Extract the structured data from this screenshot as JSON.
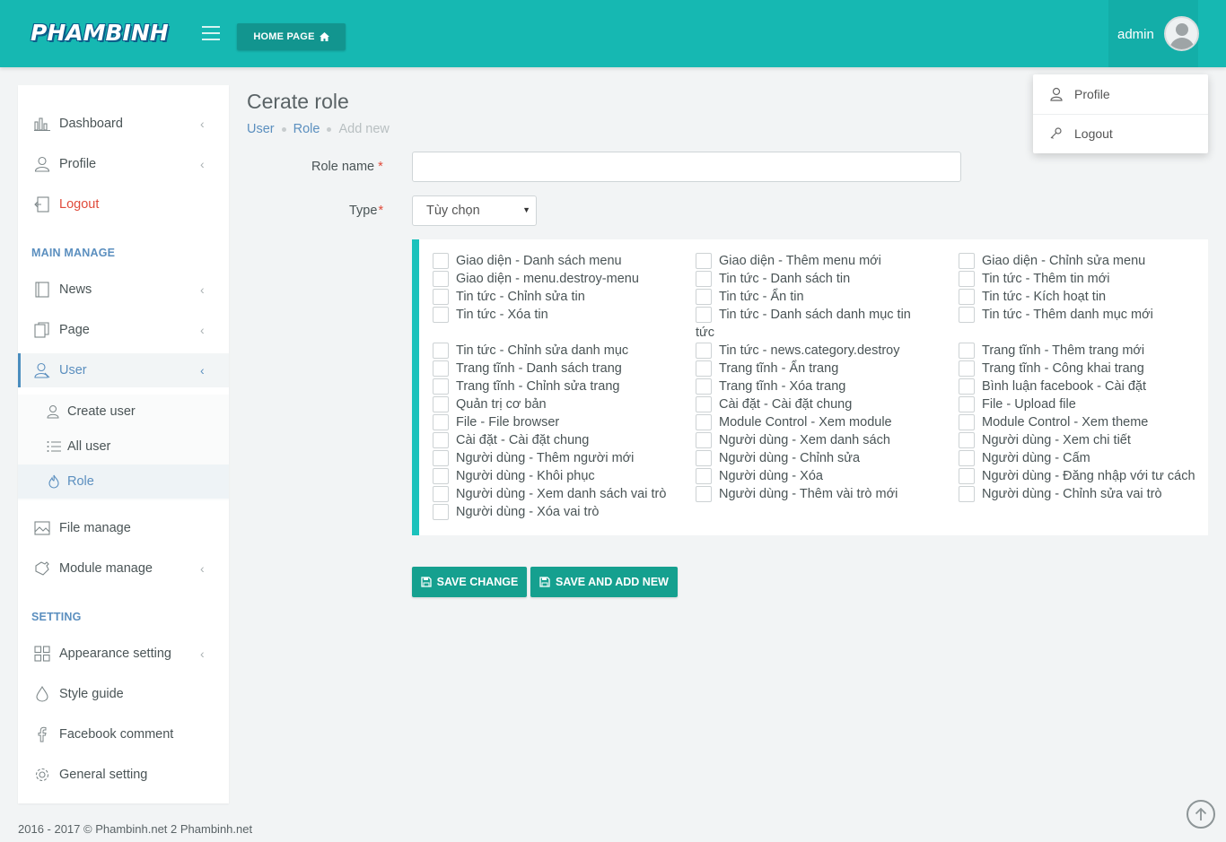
{
  "header": {
    "logo": "PHAMBINH",
    "home_button": "HOME PAGE",
    "user_name": "admin"
  },
  "user_dropdown": {
    "items": [
      {
        "label": "Profile",
        "icon": "user-icon"
      },
      {
        "label": "Logout",
        "icon": "key-icon"
      }
    ]
  },
  "sidebar": {
    "items": [
      {
        "label": "Dashboard",
        "icon": "bar-chart-icon"
      },
      {
        "label": "Profile",
        "icon": "user-icon"
      },
      {
        "label": "Logout",
        "icon": "logout-icon"
      }
    ],
    "section_main": "MAIN MANAGE",
    "main_items": [
      {
        "label": "News",
        "icon": "book-icon"
      },
      {
        "label": "Page",
        "icon": "pages-icon"
      },
      {
        "label": "User",
        "icon": "user-icon"
      }
    ],
    "user_sub_items": [
      {
        "label": "Create user",
        "icon": "user-add-icon"
      },
      {
        "label": "All user",
        "icon": "list-icon"
      },
      {
        "label": "Role",
        "icon": "fire-icon"
      }
    ],
    "more_items": [
      {
        "label": "File manage",
        "icon": "image-icon"
      },
      {
        "label": "Module manage",
        "icon": "puzzle-icon"
      }
    ],
    "section_setting": "SETTING",
    "setting_items": [
      {
        "label": "Appearance setting",
        "icon": "grid-icon"
      },
      {
        "label": "Style guide",
        "icon": "drop-icon"
      },
      {
        "label": "Facebook comment",
        "icon": "facebook-icon"
      },
      {
        "label": "General setting",
        "icon": "gear-icon"
      }
    ]
  },
  "main": {
    "title": "Cerate role",
    "breadcrumb": [
      "User",
      "Role",
      "Add new"
    ],
    "form": {
      "role_name_label": "Role name",
      "role_name_value": "",
      "type_label": "Type",
      "type_value": "Tùy chọn",
      "required_mark": "*"
    },
    "permissions": {
      "col1": [
        "Giao diện - Danh sách menu",
        "Giao diện - menu.destroy-menu",
        "Tin tức - Chỉnh sửa tin",
        "Tin tức - Xóa tin",
        "Tin tức - Chỉnh sửa danh mục",
        "Trang tĩnh - Danh sách trang",
        "Trang tĩnh - Chỉnh sửa trang",
        "Quản trị cơ bản",
        "File - File browser",
        "Cài đặt - Cài đặt chung",
        "Người dùng - Thêm người mới",
        "Người dùng - Khôi phục",
        "Người dùng - Xem danh sách vai trò",
        "Người dùng - Xóa vai trò"
      ],
      "col2": [
        "Giao diện - Thêm menu mới",
        "Tin tức - Danh sách tin",
        "Tin tức - Ẩn tin",
        "Tin tức - Danh sách danh mục tin",
        "Tin tức - news.category.destroy",
        "Trang tĩnh - Ẩn trang",
        "Trang tĩnh - Xóa trang",
        "Cài đặt - Cài đặt chung",
        "Module Control - Xem module",
        "Người dùng - Xem danh sách",
        "Người dùng - Chỉnh sửa",
        "Người dùng - Xóa",
        "Người dùng - Thêm vài trò mới"
      ],
      "col2_wrap": "tức",
      "col3": [
        "Giao diện - Chỉnh sửa menu",
        "Tin tức - Thêm tin mới",
        "Tin tức - Kích hoạt tin",
        "Tin tức - Thêm danh mục mới",
        "Trang tĩnh - Thêm trang mới",
        "Trang tĩnh - Công khai trang",
        "Bình luận facebook - Cài đặt",
        "File - Upload file",
        "Module Control - Xem theme",
        "Người dùng - Xem chi tiết",
        "Người dùng - Cấm",
        "Người dùng - Đăng nhập với tư cách",
        "Người dùng - Chỉnh sửa vai trò"
      ]
    },
    "buttons": {
      "save_change": "SAVE CHANGE",
      "save_and_add_new": "SAVE AND ADD NEW"
    }
  },
  "footer": {
    "text": "2016 - 2017 © Phambinh.net 2 Phambinh.net"
  },
  "colors": {
    "header": "#16b8b2",
    "accent": "#15a08f",
    "link": "#5b8fbf",
    "danger": "#e04b3b"
  }
}
